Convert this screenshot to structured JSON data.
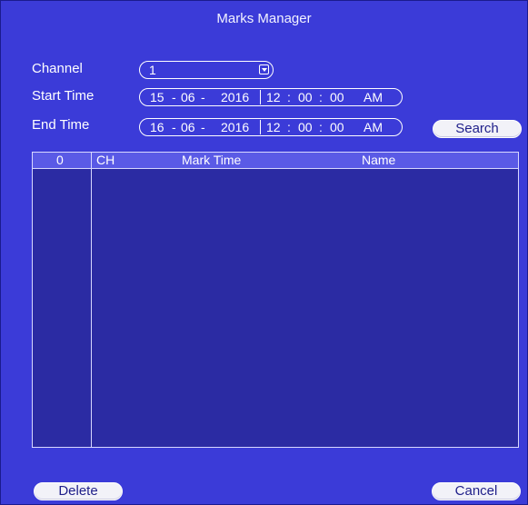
{
  "window": {
    "title": "Marks Manager"
  },
  "form": {
    "channel_label": "Channel",
    "channel_value": "1",
    "start_label": "Start Time",
    "start": {
      "day": "15",
      "month": "06",
      "year": "2016",
      "hour": "12",
      "minute": "00",
      "second": "00",
      "ampm": "AM"
    },
    "end_label": "End Time",
    "end": {
      "day": "16",
      "month": "06",
      "year": "2016",
      "hour": "12",
      "minute": "00",
      "second": "00",
      "ampm": "AM"
    },
    "date_sep": "-",
    "time_sep": ":",
    "search_label": "Search"
  },
  "table": {
    "columns": [
      "0",
      "CH",
      "Mark Time",
      "Name"
    ],
    "rows": []
  },
  "footer": {
    "delete_label": "Delete",
    "cancel_label": "Cancel"
  },
  "colors": {
    "background": "#3b3bd8",
    "table_body": "#2b2ba3",
    "table_header": "#5a5ae6",
    "button_text": "#1f1f8a"
  }
}
